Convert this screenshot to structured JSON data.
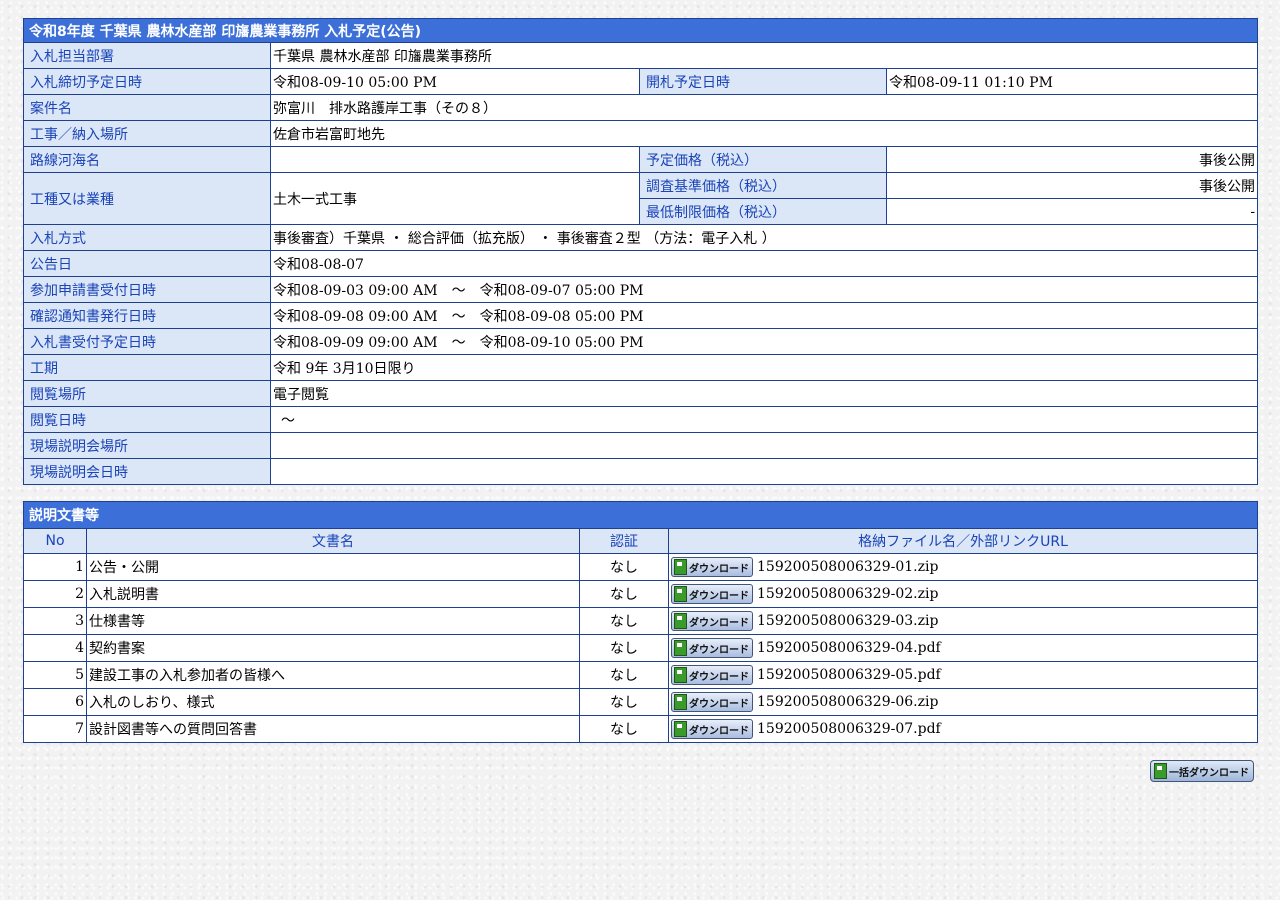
{
  "title": "令和8年度 千葉県 農林水産部 印旛農業事務所 入札予定(公告)",
  "info": {
    "dept": {
      "label": "入札担当部署",
      "value": "千葉県 農林水産部 印旛農業事務所"
    },
    "deadline": {
      "label": "入札締切予定日時",
      "value": "令和08-09-10 05:00 PM"
    },
    "opening": {
      "label": "開札予定日時",
      "value": "令和08-09-11 01:10 PM"
    },
    "project": {
      "label": "案件名",
      "value": "弥富川　排水路護岸工事（その８）"
    },
    "place": {
      "label": "工事／納入場所",
      "value": "佐倉市岩富町地先"
    },
    "route": {
      "label": "路線河海名",
      "value": ""
    },
    "planned_price": {
      "label": "予定価格（税込）",
      "value": "事後公開"
    },
    "category": {
      "label": "工種又は業種",
      "value": "土木一式工事"
    },
    "survey_price": {
      "label": "調査基準価格（税込）",
      "value": "事後公開"
    },
    "min_price": {
      "label": "最低制限価格（税込）",
      "value": "-"
    },
    "method": {
      "label": "入札方式",
      "value": "事後審査）千葉県 ・ 総合評価（拡充版） ・ 事後審査２型 （方法：電子入札 ）"
    },
    "notice_date": {
      "label": "公告日",
      "value": "令和08-08-07"
    },
    "application": {
      "label": "参加申請書受付日時",
      "value": "令和08-09-03 09:00 AM　～　令和08-09-07 05:00 PM"
    },
    "confirmation": {
      "label": "確認通知書発行日時",
      "value": "令和08-09-08 09:00 AM　～　令和08-09-08 05:00 PM"
    },
    "bid_reception": {
      "label": "入札書受付予定日時",
      "value": "令和08-09-09 09:00 AM　～　令和08-09-10 05:00 PM"
    },
    "period": {
      "label": "工期",
      "value": "令和 9年 3月10日限り"
    },
    "view_place": {
      "label": "閲覧場所",
      "value": "電子閲覧"
    },
    "view_date": {
      "label": "閲覧日時",
      "value": "～"
    },
    "site_place": {
      "label": "現場説明会場所",
      "value": ""
    },
    "site_date": {
      "label": "現場説明会日時",
      "value": ""
    }
  },
  "docs": {
    "title": "説明文書等",
    "headers": {
      "no": "No",
      "name": "文書名",
      "auth": "認証",
      "file": "格納ファイル名／外部リンクURL"
    },
    "download_label": "ダウンロード",
    "rows": [
      {
        "no": "1",
        "name": "公告・公開",
        "auth": "なし",
        "file": "159200508006329-01.zip"
      },
      {
        "no": "2",
        "name": "入札説明書",
        "auth": "なし",
        "file": "159200508006329-02.zip"
      },
      {
        "no": "3",
        "name": "仕様書等",
        "auth": "なし",
        "file": "159200508006329-03.zip"
      },
      {
        "no": "4",
        "name": "契約書案",
        "auth": "なし",
        "file": "159200508006329-04.pdf"
      },
      {
        "no": "5",
        "name": "建設工事の入札参加者の皆様へ",
        "auth": "なし",
        "file": "159200508006329-05.pdf"
      },
      {
        "no": "6",
        "name": "入札のしおり、様式",
        "auth": "なし",
        "file": "159200508006329-06.zip"
      },
      {
        "no": "7",
        "name": "設計図書等への質問回答書",
        "auth": "なし",
        "file": "159200508006329-07.pdf"
      }
    ]
  },
  "bulk_download_label": "一括ダウンロード",
  "icons": {
    "download": "floppy-disk-icon"
  },
  "colors": {
    "header_bg": "#3c6fd8",
    "label_bg": "#dbe6f6",
    "label_text": "#1a44b8",
    "border": "#1f3f8f"
  }
}
